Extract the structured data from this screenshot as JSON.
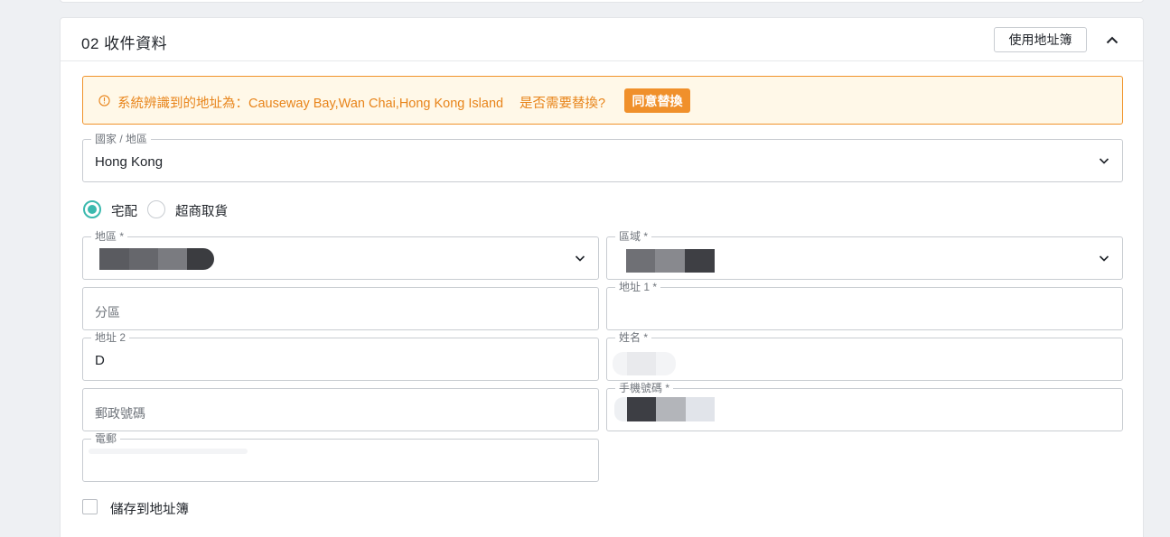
{
  "section": {
    "title": "02 收件資料",
    "address_book_button": "使用地址簿",
    "collapse_icon": "chevron-up-icon"
  },
  "alert": {
    "icon": "info-circle-icon",
    "message": "系統辨識到的地址為：Causeway Bay,Wan Chai,Hong Kong Island",
    "question": "是否需要替換?",
    "agree_button": "同意替換",
    "color": "#f0902b"
  },
  "country": {
    "label": "國家 / 地區",
    "value": "Hong Kong"
  },
  "delivery": {
    "home_label": "宅配",
    "store_label": "超商取貨",
    "selected": "宅配",
    "accent_color": "#3bb9ae"
  },
  "fields": {
    "region_label": "地區 *",
    "area_label": "區域 *",
    "district_placeholder": "分區",
    "address1_label": "地址 1 *",
    "address2_label": "地址 2",
    "address2_value": "D",
    "name_label": "姓名 *",
    "postal_placeholder": "郵政號碼",
    "phone_label": "手機號碼 *",
    "email_label": "電郵"
  },
  "save_label": "儲存到地址簿"
}
